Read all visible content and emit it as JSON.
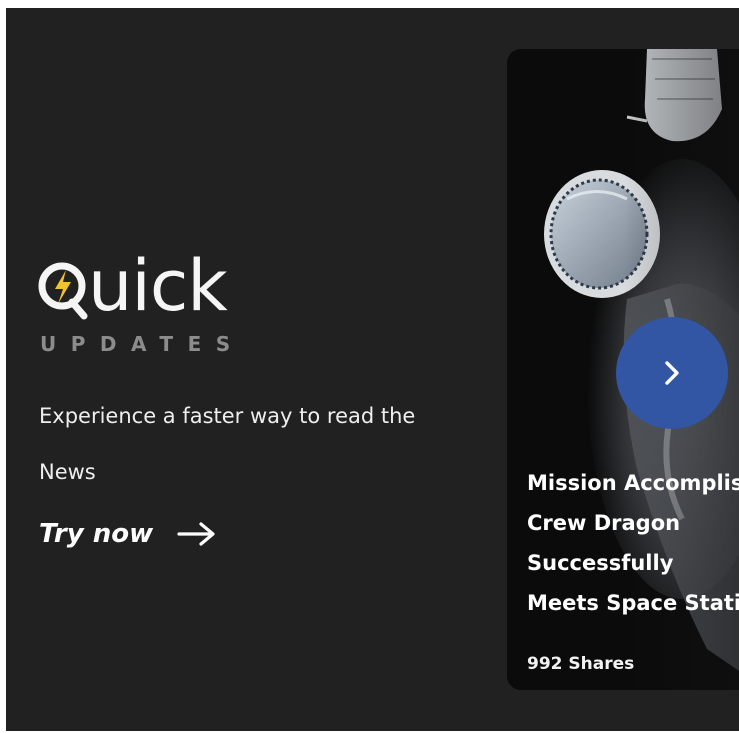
{
  "brand": {
    "logo_word": "uick",
    "logo_q": "Q",
    "logo_subtitle": "UPDATES"
  },
  "hero": {
    "tagline": "Experience a faster way to read the\nNews",
    "cta_label": "Try now"
  },
  "card": {
    "headline": "Mission Accomplished:\nCrew Dragon Successfully\nMeets Space Station",
    "shares": "992 Shares",
    "image_subject": "astronaut-in-space"
  },
  "icons": {
    "logo_bolt": "lightning-bolt-icon",
    "cta_arrow": "arrow-right-icon",
    "next": "chevron-right-icon"
  },
  "colors": {
    "background": "#212121",
    "bolt": "#f2c12e",
    "next_button": "#3255a4"
  }
}
